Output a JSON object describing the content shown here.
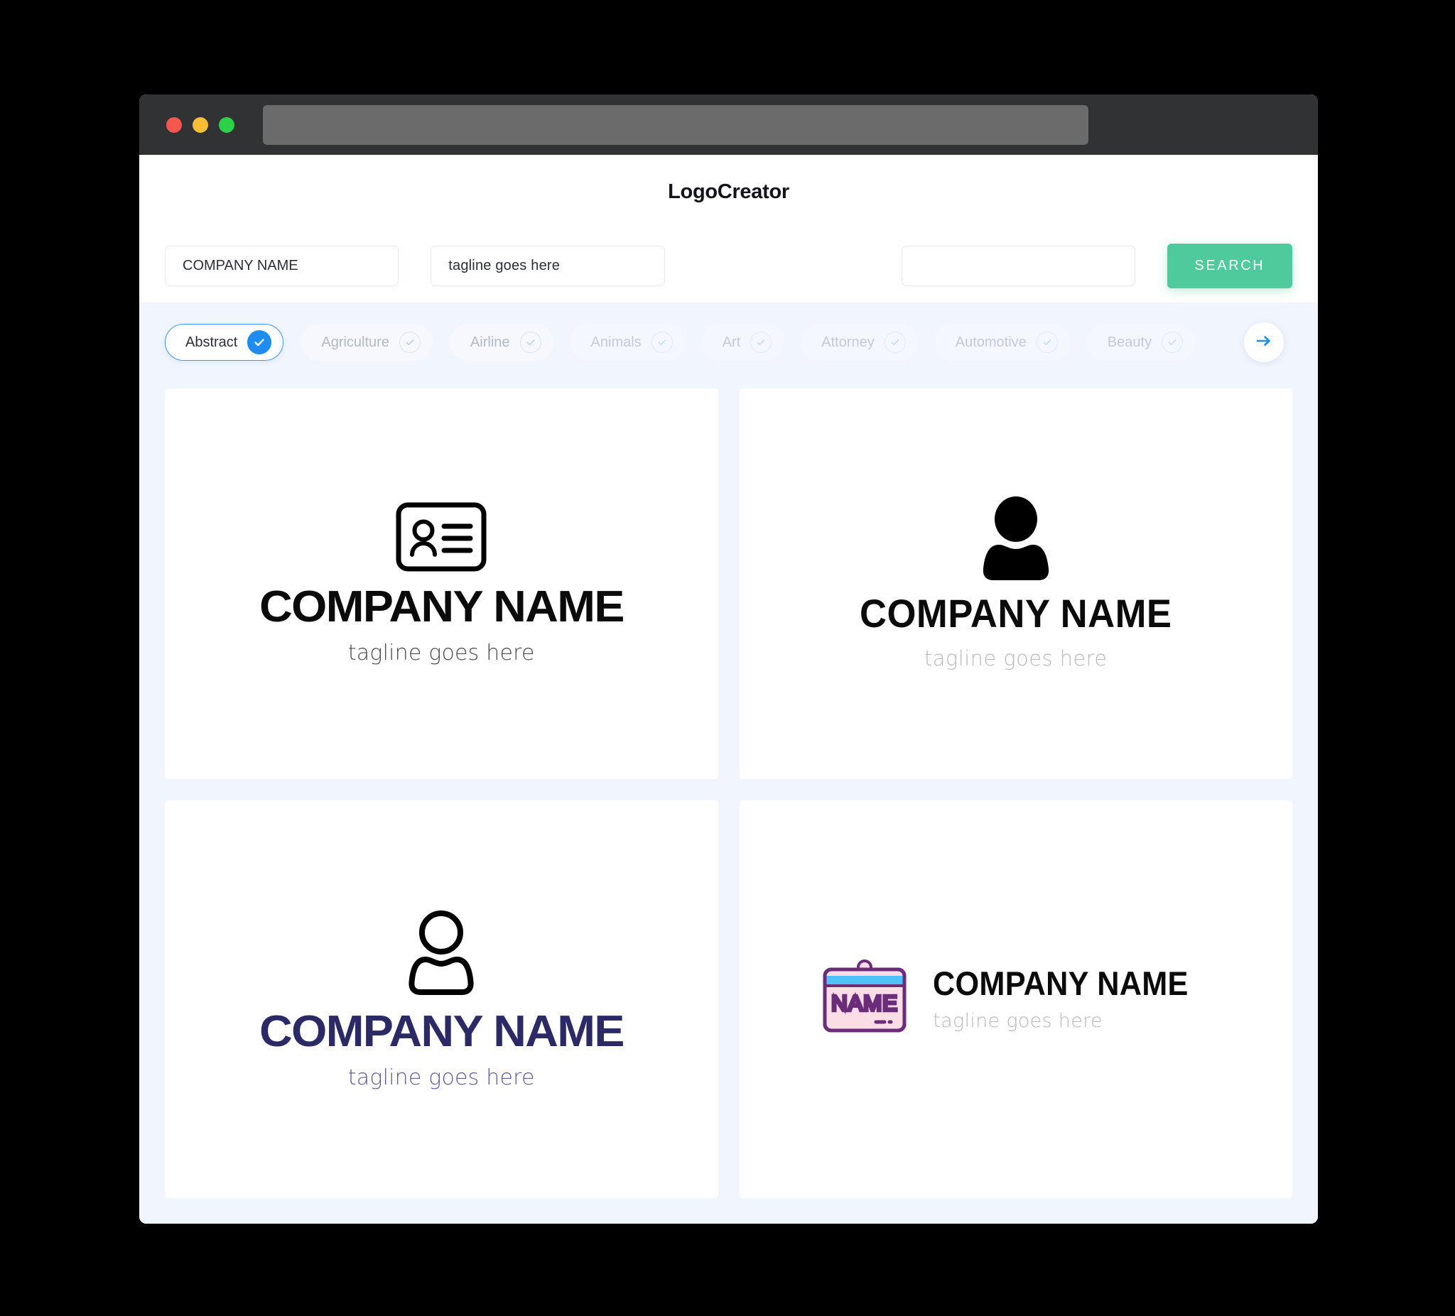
{
  "window": {
    "traffic_lights": [
      "close",
      "minimize",
      "maximize"
    ],
    "url_value": "",
    "chrome_color": "#303234",
    "urlbar_color": "#6B6B6B"
  },
  "header": {
    "title": "LogoCreator"
  },
  "search": {
    "company_value": "COMPANY NAME",
    "company_placeholder": "COMPANY NAME",
    "tagline_value": "tagline goes here",
    "tagline_placeholder": "tagline goes here",
    "extra_value": "",
    "extra_placeholder": "",
    "button_label": "SEARCH",
    "button_color": "#4FCA9C"
  },
  "categories": {
    "next_arrow_label": "→",
    "accent_color": "#1E8CF0",
    "items": [
      {
        "label": "Abstract",
        "selected": true
      },
      {
        "label": "Agriculture",
        "selected": false
      },
      {
        "label": "Airline",
        "selected": false
      },
      {
        "label": "Animals",
        "selected": false
      },
      {
        "label": "Art",
        "selected": false
      },
      {
        "label": "Attorney",
        "selected": false
      },
      {
        "label": "Automotive",
        "selected": false
      },
      {
        "label": "Beauty",
        "selected": false
      }
    ]
  },
  "results": {
    "cards": [
      {
        "icon": "id-card-icon",
        "name": "COMPANY NAME",
        "tagline": "tagline goes here",
        "name_color": "#0b0b0b",
        "tagline_color": "#4a4a4a",
        "layout": "vertical"
      },
      {
        "icon": "person-filled-icon",
        "name": "COMPANY NAME",
        "tagline": "tagline goes here",
        "name_color": "#0b0b0b",
        "tagline_color": "#b9b9b9",
        "layout": "vertical"
      },
      {
        "icon": "person-outline-icon",
        "name": "COMPANY NAME",
        "tagline": "tagline goes here",
        "name_color": "#2B2A66",
        "tagline_color": "#5D5B9A",
        "layout": "vertical"
      },
      {
        "icon": "name-badge-icon",
        "badge_text": "NAME",
        "name": "COMPANY NAME",
        "tagline": "tagline goes here",
        "name_color": "#0b0b0b",
        "tagline_color": "#b9b9b9",
        "layout": "horizontal",
        "badge_colors": {
          "outline": "#6B2D7A",
          "body": "#FBDDE5",
          "top": "#4FC3F7"
        }
      }
    ]
  },
  "theme": {
    "page_background": "#000000",
    "app_background": "#F1F5FE",
    "card_background": "#ffffff"
  }
}
